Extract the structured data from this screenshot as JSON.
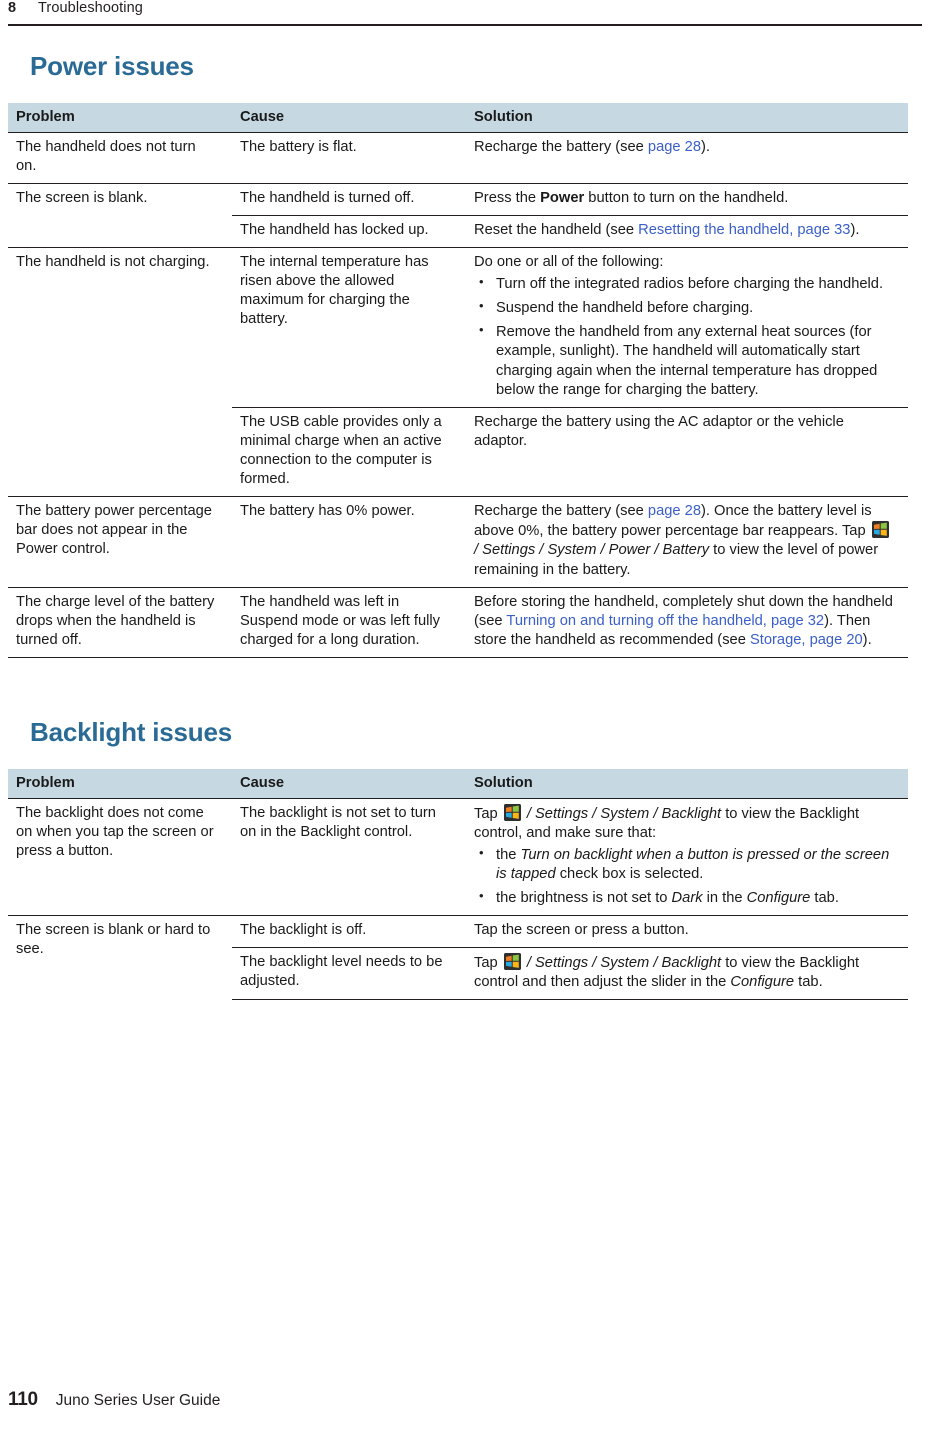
{
  "running_head": {
    "chapter_number": "8",
    "chapter_title": "Troubleshooting"
  },
  "sections": [
    {
      "heading": "Power issues",
      "table": {
        "columns": [
          "Problem",
          "Cause",
          "Solution"
        ]
      }
    },
    {
      "heading": "Backlight issues",
      "table": {
        "columns": [
          "Problem",
          "Cause",
          "Solution"
        ]
      }
    }
  ],
  "power_table": {
    "header": {
      "problem": "Problem",
      "cause": "Cause",
      "solution": "Solution"
    },
    "rows": [
      {
        "problem": "The handheld does not turn on.",
        "cause": "The battery is flat.",
        "solution_prefix": "Recharge the battery (see ",
        "solution_link": "page 28",
        "solution_suffix": ")."
      },
      {
        "problem": "The screen is blank.",
        "cause": "The handheld is turned off.",
        "solution_prefix": "Press the ",
        "solution_bold": "Power",
        "solution_suffix": " button to turn on the handheld."
      },
      {
        "cause": "The handheld has locked up.",
        "solution_prefix": "Reset the handheld (see ",
        "solution_link": "Resetting the handheld, page 33",
        "solution_suffix": ")."
      },
      {
        "problem": "The handheld is not charging.",
        "cause": "The internal temperature has risen above the allowed maximum for charging the battery.",
        "solution_lead": "Do one or all of the following:",
        "solution_bullets": [
          "Turn off the integrated radios before charging the handheld.",
          "Suspend the handheld before charging.",
          "Remove the handheld from any external heat sources (for example, sunlight). The handheld will automatically start charging again when the internal temperature has dropped below the range for charging the battery."
        ]
      },
      {
        "cause": "The USB cable provides only a minimal charge when an active connection to the computer is formed.",
        "solution_plain": "Recharge the battery using the AC adaptor or the vehicle adaptor."
      },
      {
        "problem": "The battery power percentage bar does not appear in the Power control.",
        "cause": "The battery has 0% power.",
        "solution_seg1": "Recharge the battery (see ",
        "solution_link1": "page 28",
        "solution_seg2": "). Once the battery level is above 0%, the battery power percentage bar reappears. Tap ",
        "solution_icon": "windows-start-orb-icon",
        "solution_path": " / Settings / System / Power  / Battery",
        "solution_seg3": " to view the level of power remaining in the battery."
      },
      {
        "problem": "The charge level of the battery drops when the handheld is turned off.",
        "cause": "The handheld was left in Suspend mode or was left fully charged for a long duration.",
        "solution_seg1": "Before storing the handheld, completely shut down the handheld (see ",
        "solution_link1": "Turning on and turning off the handheld, page 32",
        "solution_seg2": "). Then store the handheld as recommended (see ",
        "solution_link2": "Storage, page 20",
        "solution_seg3": ")."
      }
    ]
  },
  "backlight_table": {
    "header": {
      "problem": "Problem",
      "cause": "Cause",
      "solution": "Solution"
    },
    "rows": [
      {
        "problem": "The backlight does not come on when you tap the screen or press a button.",
        "cause": "The backlight is not set to turn on in the Backlight control.",
        "solution_tap": "Tap ",
        "solution_icon": "windows-start-orb-icon",
        "solution_path": " / Settings / System / Backlight",
        "solution_tail": " to view the Backlight control, and make sure that:",
        "solution_bullets": [
          {
            "pre": "the ",
            "ital": "Turn on backlight when a button is pressed or the screen is tapped",
            "post": " check box is selected."
          },
          {
            "pre": "the brightness is not set to ",
            "ital": "Dark",
            "mid": " in the ",
            "ital2": "Configure",
            "post": " tab."
          }
        ]
      },
      {
        "problem": "The screen is blank or hard to see.",
        "cause": "The backlight is off.",
        "solution_plain": "Tap the screen or press a button."
      },
      {
        "cause": "The backlight level needs to be adjusted.",
        "solution_tap": "Tap ",
        "solution_icon": "windows-start-orb-icon",
        "solution_path": " / Settings / System / Backlight",
        "solution_tail": " to view the Backlight control and then adjust the slider in the ",
        "solution_ital_tail": "Configure",
        "solution_tail2": " tab."
      }
    ]
  },
  "footer": {
    "page_number": "110",
    "book_title": "Juno Series User Guide"
  },
  "colors": {
    "heading_blue": "#2a6b96",
    "table_header_band": "#c6d9e3",
    "link_blue": "#3a5fc8",
    "rule_black": "#231f20"
  }
}
